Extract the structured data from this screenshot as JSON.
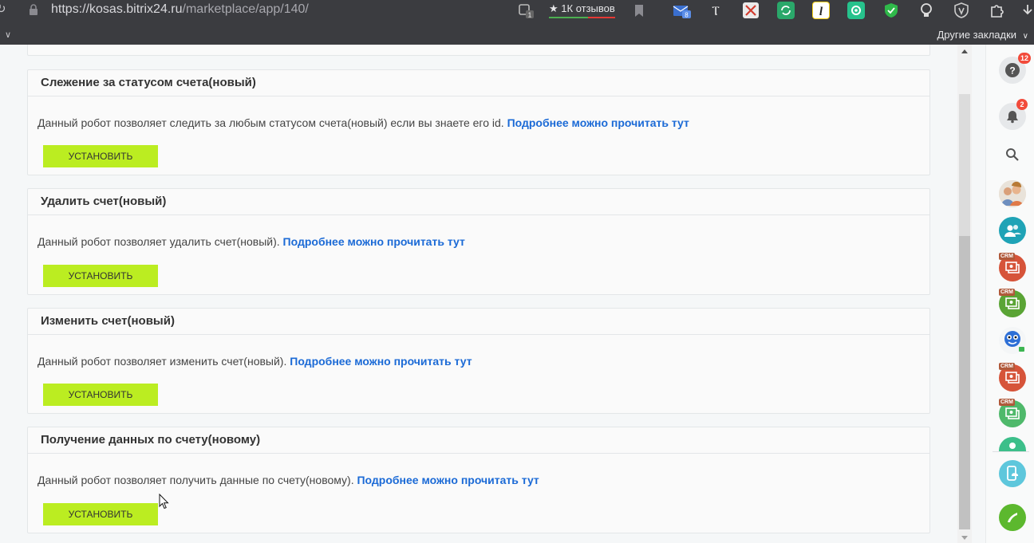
{
  "browser": {
    "url_host": "https://kosas.bitrix24.ru",
    "url_path": "/marketplace/app/140/",
    "reviews_label": "1К отзывов",
    "other_bookmarks_label": "Другие закладки",
    "ext_badge_count": "1",
    "mail_badge_count": "8"
  },
  "robots": [
    {
      "title": "Слежение за статусом счета(новый)",
      "description": "Данный робот позволяет следить за любым статусом счета(новый) если вы знаете его id.",
      "link": "Подробнее можно прочитать тут",
      "button": "Установить"
    },
    {
      "title": "Удалить счет(новый)",
      "description": "Данный робот позволяет удалить счет(новый).",
      "link": "Подробнее можно прочитать тут",
      "button": "Установить"
    },
    {
      "title": "Изменить счет(новый)",
      "description": "Данный робот позволяет изменить счет(новый).",
      "link": "Подробнее можно прочитать тут",
      "button": "Установить"
    },
    {
      "title": "Получение данных по счету(новому)",
      "description": "Данный робот позволяет получить данные по счету(новому).",
      "link": "Подробнее можно прочитать тут",
      "button": "Установить"
    }
  ],
  "rightbar": {
    "help_badge": "12",
    "notifications_badge": "2",
    "crm_tag": "CRM"
  },
  "colors": {
    "install_button": "#bbed21",
    "link": "#1b6ad6",
    "badge": "#f24b3b",
    "topbar": "#3b3c40"
  }
}
